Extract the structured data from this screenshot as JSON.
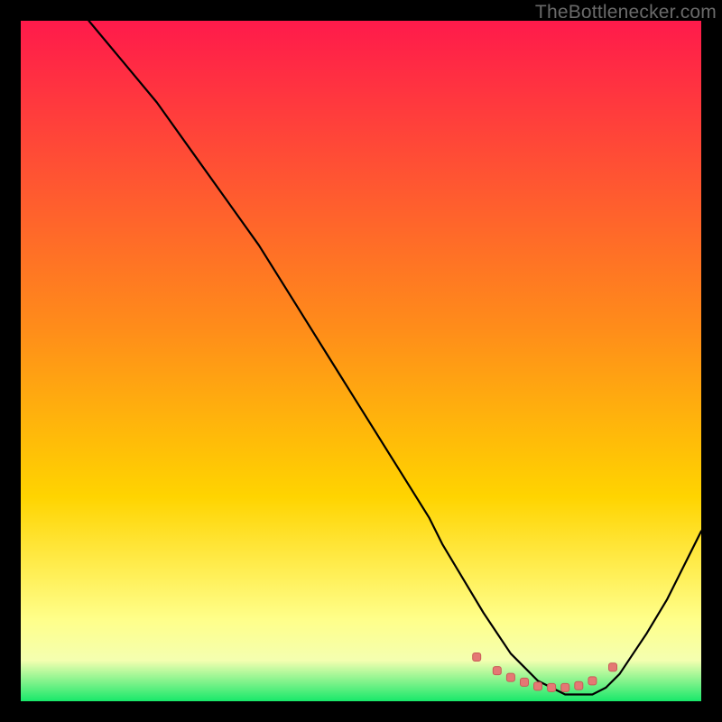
{
  "watermark": "TheBottlenecker.com",
  "colors": {
    "top": "#ff1a4b",
    "mid": "#ffd400",
    "low": "#ffff8a",
    "bottom": "#18e86a",
    "curve": "#000000",
    "marker_fill": "#e47874",
    "marker_stroke": "#c85b57",
    "frame": "#000000"
  },
  "chart_data": {
    "type": "line",
    "title": "",
    "xlabel": "",
    "ylabel": "",
    "xlim": [
      0,
      100
    ],
    "ylim": [
      0,
      100
    ],
    "grid": false,
    "legend": false,
    "series": [
      {
        "name": "bottleneck-curve",
        "x": [
          10,
          15,
          20,
          25,
          30,
          35,
          40,
          45,
          50,
          55,
          60,
          62,
          65,
          68,
          70,
          72,
          74,
          76,
          78,
          80,
          82,
          84,
          86,
          88,
          90,
          92,
          95,
          100
        ],
        "y": [
          100,
          94,
          88,
          81,
          74,
          67,
          59,
          51,
          43,
          35,
          27,
          23,
          18,
          13,
          10,
          7,
          5,
          3,
          2,
          1,
          1,
          1,
          2,
          4,
          7,
          10,
          15,
          25
        ]
      }
    ],
    "markers": {
      "name": "optimal-range-dots",
      "x": [
        67,
        70,
        72,
        74,
        76,
        78,
        80,
        82,
        84,
        87
      ],
      "y": [
        6.5,
        4.5,
        3.5,
        2.8,
        2.2,
        2.0,
        2.0,
        2.3,
        3.0,
        5.0
      ]
    }
  }
}
